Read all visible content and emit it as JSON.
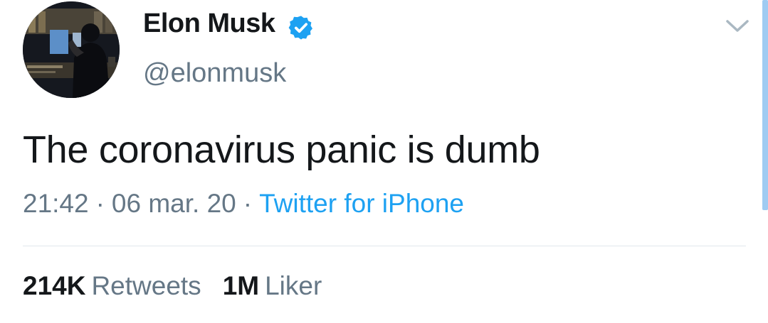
{
  "user": {
    "display_name": "Elon Musk",
    "handle": "@elonmusk",
    "verified": true
  },
  "tweet": {
    "text": "The coronavirus panic is dumb",
    "time": "21:42",
    "separator": "·",
    "date": "06 mar. 20",
    "source": "Twitter for iPhone"
  },
  "stats": {
    "retweets_count": "214K",
    "retweets_label": "Retweets",
    "likes_count": "1M",
    "likes_label": "Liker"
  },
  "icons": {
    "verified": "verified-badge-icon",
    "menu": "chevron-down-icon"
  },
  "colors": {
    "text": "#14171a",
    "secondary": "#657786",
    "link": "#1da1f2",
    "verified": "#1da1f2",
    "divider": "#e1e8ed"
  }
}
